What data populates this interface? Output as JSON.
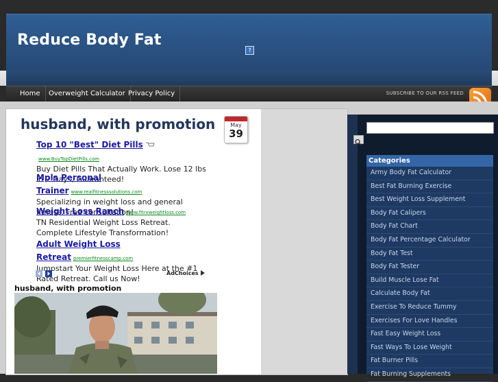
{
  "site": {
    "title": "Reduce Body Fat",
    "help_badge": "?"
  },
  "nav": {
    "items": [
      "Home",
      "Overweight Calculator",
      "Privacy Policy"
    ],
    "rss_label": "SUBSCRIBE TO OUR RSS FEED"
  },
  "post": {
    "title": "husband, with promotion",
    "date": {
      "month": "May",
      "day": "39"
    },
    "subheading": "husband, with promotion"
  },
  "ads": [
    {
      "title": "Top 10 \"Best\" Diet Pills",
      "url": "www.BuyTopDietPills.com",
      "desc": "Buy Diet Pills That Actually Work. Lose 12 lbs in 7 Days, Guaranteed!"
    },
    {
      "title": "Mpls Personal Trainer",
      "url": "www.realfitnesssolutions.com",
      "desc": "Specializing in weight loss and general fitness. Free consultation!"
    },
    {
      "title": "Weight Loss Ranch",
      "url": "www.fitrxweightloss.com",
      "desc": "TN Residential Weight Loss Retreat. Complete Lifestyle Transformation!"
    },
    {
      "title": "Adult Weight Loss Retreat",
      "url": "premierfitnesscamp.com",
      "desc": "Jumpstart Your Weight Loss Here at the #1 Rated Retreat. Call us Now!"
    }
  ],
  "adchoices": "AdChoices",
  "sidebar": {
    "categories_title": "Categories",
    "categories": [
      "Army Body Fat Calculator",
      "Best Fat Burning Exercise",
      "Best Weight Loss Supplement",
      "Body Fat Calipers",
      "Body Fat Chart",
      "Body Fat Percentage Calculator",
      "Body Fat Test",
      "Body Fat Tester",
      "Build Muscle Lose Fat",
      "Calculate Body Fat",
      "Exercise To Reduce Tummy",
      "Exercises For Love Handles",
      "Fast Easy Weight Loss",
      "Fast Ways To Lose Weight",
      "Fat Burner Pills",
      "Fat Burning Supplements"
    ]
  },
  "colors": {
    "header_blue": "#2f5f95",
    "title_navy": "#23375c",
    "ad_link": "#1a1aa6",
    "ad_url": "#0a8a1c",
    "sidebar_dark": "#0e1c2e",
    "category_header": "#3466a7"
  },
  "icons": {
    "rss": "rss-icon",
    "search": "magnifier-icon",
    "calendar": "calendar-icon"
  }
}
